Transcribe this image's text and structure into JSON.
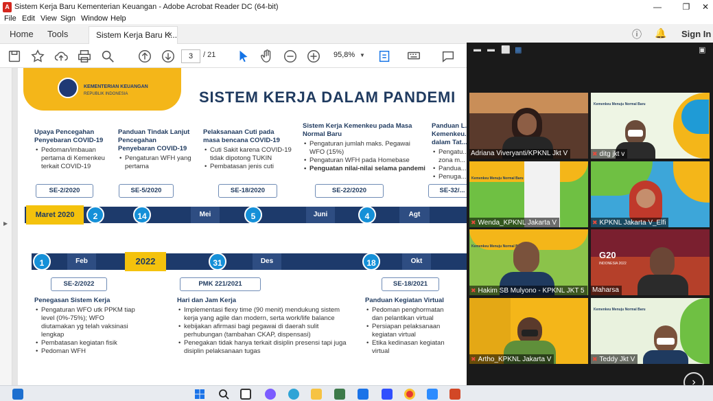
{
  "window": {
    "title": "Sistem Kerja Baru Kementerian Keuangan - Adobe Acrobat Reader DC (64-bit)",
    "app_icon": "acrobat-icon",
    "controls": [
      "minimize-icon",
      "restore-icon",
      "close-icon"
    ]
  },
  "menu": [
    "File",
    "Edit",
    "View",
    "Sign",
    "Window",
    "Help"
  ],
  "tabs": {
    "home": "Home",
    "tools": "Tools",
    "doc": "Sistem Kerja Baru K...",
    "close": "×",
    "sign_in": "Sign In"
  },
  "toolbar": {
    "page_current": "3",
    "page_total": "/ 21",
    "zoom": "95,8%"
  },
  "slide": {
    "org_line1": "KEMENTERIAN KEUANGAN",
    "org_line2": "REPUBLIK INDONESIA",
    "headline": "SISTEM KERJA DALAM PANDEMI",
    "top_cols": [
      {
        "heading": "Upaya Pencegahan Penyebaran COVID-19",
        "items": [
          "Pedoman/imbauan pertama di Kemenkeu terkait COVID-19"
        ]
      },
      {
        "heading": "Panduan Tindak Lanjut Pencegahan Penyebaran COVID-19",
        "items": [
          "Pengaturan WFH yang pertama"
        ]
      },
      {
        "heading": "Pelaksanaan Cuti pada masa bencana COVID-19",
        "items": [
          "Cuti Sakit karena COVID-19 tidak dipotong TUKIN",
          "Pembatasan jenis cuti"
        ]
      },
      {
        "heading": "Sistem Kerja Kemenkeu pada Masa Normal Baru",
        "items": [
          "Pengaturan jumlah maks. Pegawai WFO (15%)",
          "Pengaturan WFH pada Homebase",
          "Penguatan nilai-nilai selama pandemi"
        ]
      },
      {
        "heading": "Panduan L... Kemenkeu... dalam Tat...",
        "items": [
          "Pengatu... zona m...",
          "Pandua...",
          "Penuga..."
        ]
      }
    ],
    "top_callouts": [
      "SE-2/2020",
      "SE-5/2020",
      "SE-18/2020",
      "SE-22/2020",
      "SE-32/..."
    ],
    "timeline1": {
      "start": "Maret 2020",
      "dates": [
        "2",
        "14",
        "5",
        "4"
      ],
      "months": [
        "Mei",
        "Juni",
        "Agt"
      ]
    },
    "timeline2": {
      "year": "2022",
      "dates": [
        "1",
        "31",
        "18"
      ],
      "months": [
        "Feb",
        "Des",
        "Okt"
      ]
    },
    "bottom_callouts": [
      "SE-2/2022",
      "PMK 221/2021",
      "SE-18/2021"
    ],
    "bottom_cols": [
      {
        "heading": "Penegasan Sistem Kerja",
        "items": [
          "Pengaturan WFO utk PPKM tiap level (0%-75%); WFO diutamakan yg telah vaksinasi lengkap",
          "Pembatasan kegiatan fisik",
          "Pedoman WFH"
        ]
      },
      {
        "heading": "Hari dan Jam Kerja",
        "items": [
          "Implementasi flexy time (90 menit) mendukung sistem kerja yang agile dan modern, serta work/life balance",
          "kebijakan afirmasi bagi pegawai di daerah sulit perhubungan (tambahan CKAP, dispensasi)",
          "Penegakan tidak hanya terkait disiplin presensi tapi juga disiplin pelaksanaan tugas"
        ]
      },
      {
        "heading": "Panduan Kegiatan Virtual",
        "items": [
          "Pedoman penghormatan dan pelantikan virtual",
          "Persiapan pelaksanaan kegiatan virtual",
          "Etika kedinasan kegiatan virtual"
        ]
      }
    ]
  },
  "zoom": {
    "participants": [
      {
        "name": "Adriana Viveryanti/KPKNL Jkt V",
        "bg": "#5a3a2c"
      },
      {
        "name": "ditg jkt v",
        "bg": "#eef5e4"
      },
      {
        "name": "Wenda_KPKNL Jakarta V",
        "bg": "#6fc043"
      },
      {
        "name": "KPKNL Jakarta V_Elfi",
        "bg": "#3da6d9"
      },
      {
        "name": "Hakim SB Mulyono - KPKNL JKT 5",
        "bg": "#8bc34a"
      },
      {
        "name": "Maharsa",
        "bg": "#b5402a"
      },
      {
        "name": "Artho_KPKNL Jakarta V",
        "bg": "#f4b619"
      },
      {
        "name": "Teddy Jkt V",
        "bg": "#e9f2de"
      }
    ],
    "background_text": "Kemenkeu Menuju Normal Baru",
    "g20": "G20",
    "g20_sub": "INDONESIA 2022"
  },
  "taskbar": {
    "icons": [
      "start-icon",
      "search-icon",
      "task-view-icon",
      "chat-icon",
      "edge-icon",
      "explorer-icon",
      "calculator-icon",
      "mail-icon",
      "app-icon",
      "chrome-icon",
      "zoom-icon",
      "powerpoint-icon"
    ]
  }
}
